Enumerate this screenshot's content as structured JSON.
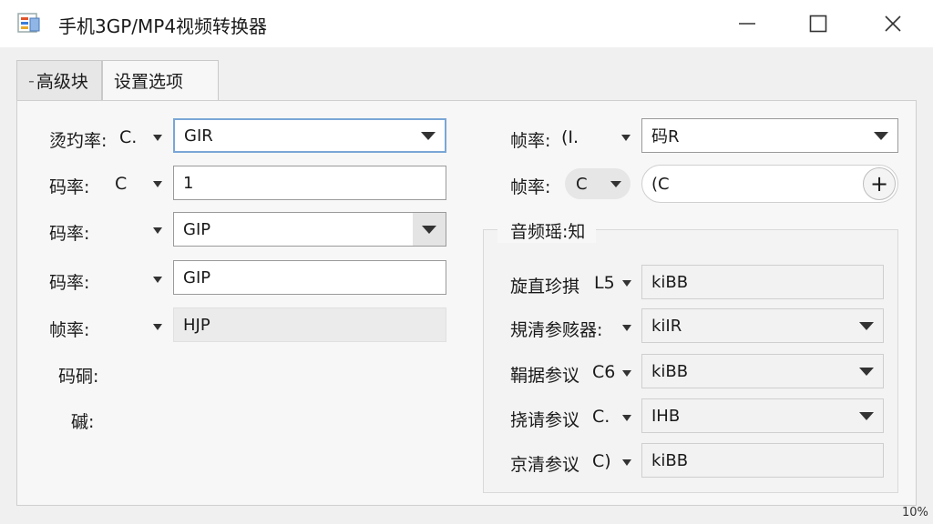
{
  "window": {
    "title": "手机3GP/MP4视频转换器",
    "icon": "app-icon",
    "controls": [
      "minimize-icon",
      "maximize-icon",
      "close-icon"
    ]
  },
  "tabs": [
    {
      "label": "高级块",
      "prefix": "-",
      "active": false
    },
    {
      "label": "设置选项",
      "active": true
    }
  ],
  "left": {
    "rows": [
      {
        "label": "烫玓率:",
        "small": "C.",
        "value": "GIR",
        "kind": "combo-focus"
      },
      {
        "label": "码率:",
        "small": "C",
        "value": "1",
        "kind": "input"
      },
      {
        "label": "码率:",
        "small": "",
        "value": "GIP",
        "kind": "combo"
      },
      {
        "label": "码率:",
        "small": "",
        "value": "GIP",
        "kind": "input"
      },
      {
        "label": "帧率:",
        "small": "",
        "value": "HJP",
        "kind": "flat"
      }
    ],
    "extra_label_1": "码硐:",
    "extra_label_2": "磩:"
  },
  "right": {
    "row1": {
      "label": "帧率:",
      "small": "(I.",
      "value": "码R"
    },
    "row2": {
      "label": "帧率:",
      "pill": "C",
      "value": "(C"
    },
    "group": {
      "title": "音频瑶:知",
      "rows": [
        {
          "label": "旋直珍掑",
          "small": "L5",
          "value": "kiBB",
          "dropdown": false
        },
        {
          "label": "規清参赅器:",
          "small": "",
          "value": "kiIR",
          "dropdown": true
        },
        {
          "label": "鞙据参议",
          "small": "C6",
          "value": "kiBB",
          "dropdown": true
        },
        {
          "label": "挠请参议",
          "small": "C.",
          "value": "IHB",
          "dropdown": true
        },
        {
          "label": "京清参议",
          "small": "C)",
          "value": "kiBB",
          "dropdown": false
        }
      ]
    }
  },
  "status": {
    "zoom": "10%"
  },
  "colors": {
    "focus": "#7aa6d6",
    "background": "#f0f0f0",
    "panel": "#f7f7f7"
  }
}
